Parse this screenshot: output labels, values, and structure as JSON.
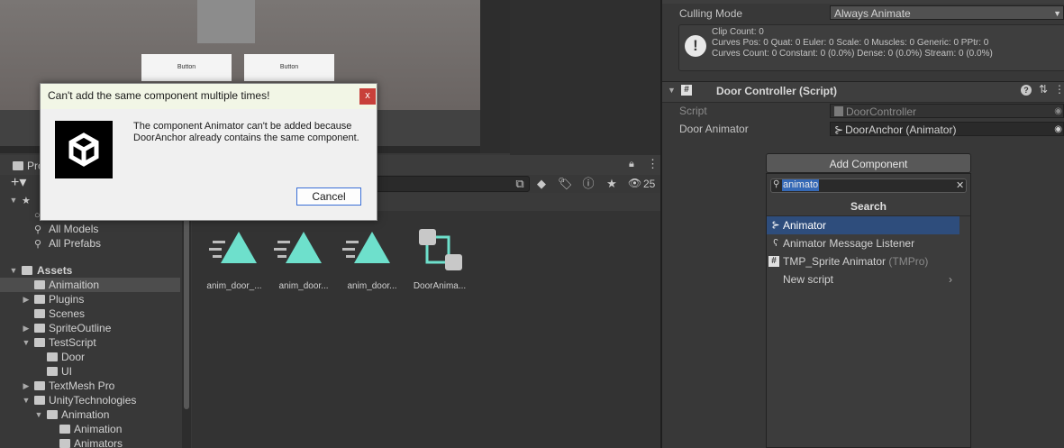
{
  "scene": {
    "button_labels": [
      "Button",
      "Button"
    ]
  },
  "project": {
    "tab_label": "Pro",
    "visibility_count": "25",
    "tree": [
      {
        "label": "",
        "type": "fav-root"
      },
      {
        "label": "",
        "type": "search"
      },
      {
        "label": "All Models",
        "type": "search"
      },
      {
        "label": "All Prefabs",
        "type": "search"
      },
      {
        "label": "Assets",
        "type": "root"
      },
      {
        "label": "Animaition",
        "type": "folder",
        "selected": true
      },
      {
        "label": "Plugins",
        "type": "folder"
      },
      {
        "label": "Scenes",
        "type": "folder"
      },
      {
        "label": "SpriteOutline",
        "type": "folder"
      },
      {
        "label": "TestScript",
        "type": "folder"
      },
      {
        "label": "Door",
        "type": "folder"
      },
      {
        "label": "UI",
        "type": "folder"
      },
      {
        "label": "TextMesh Pro",
        "type": "folder"
      },
      {
        "label": "UnityTechnologies",
        "type": "folder"
      },
      {
        "label": "Animation",
        "type": "folder"
      },
      {
        "label": "Animation",
        "type": "folder"
      },
      {
        "label": "Animators",
        "type": "folder"
      }
    ],
    "assets": [
      {
        "label": "anim_door_...",
        "icon": "animation-clip-icon"
      },
      {
        "label": "anim_door...",
        "icon": "animation-clip-icon"
      },
      {
        "label": "anim_door...",
        "icon": "animation-clip-icon"
      },
      {
        "label": "DoorAnima...",
        "icon": "animator-controller-icon"
      }
    ]
  },
  "inspector": {
    "culling_mode_label": "Culling Mode",
    "culling_mode_value": "Always Animate",
    "info_lines": [
      "Clip Count: 0",
      "Curves Pos: 0 Quat: 0 Euler: 0 Scale: 0 Muscles: 0 Generic: 0 PPtr: 0",
      "Curves Count: 0 Constant: 0 (0.0%) Dense: 0 (0.0%) Stream: 0 (0.0%)"
    ],
    "component_title": "Door Controller (Script)",
    "script_label": "Script",
    "script_value": "DoorController",
    "door_animator_label": "Door Animator",
    "door_animator_value": "DoorAnchor (Animator)"
  },
  "add_component": {
    "button_label": "Add Component",
    "search_value": "animato",
    "title": "Search",
    "items": [
      {
        "label": "Animator",
        "suffix": "",
        "selected": true,
        "icon": "animator-icon"
      },
      {
        "label": "Animator Message Listener",
        "suffix": "",
        "selected": false,
        "icon": "ear-icon"
      },
      {
        "label": "TMP_Sprite Animator",
        "suffix": "(TMPro)",
        "selected": false,
        "icon": "script-icon"
      },
      {
        "label": "New script",
        "suffix": "",
        "selected": false,
        "icon": ""
      }
    ]
  },
  "dialog": {
    "title": "Can't add the same component multiple times!",
    "close_label": "x",
    "message_line1": "The component Animator can't be added because",
    "message_line2": "DoorAnchor already contains the same component.",
    "cancel_label": "Cancel"
  },
  "colors": {
    "asset_icon": "#6ee0cc",
    "selection": "#2e4d7c",
    "dialog_close": "#c8403a"
  }
}
